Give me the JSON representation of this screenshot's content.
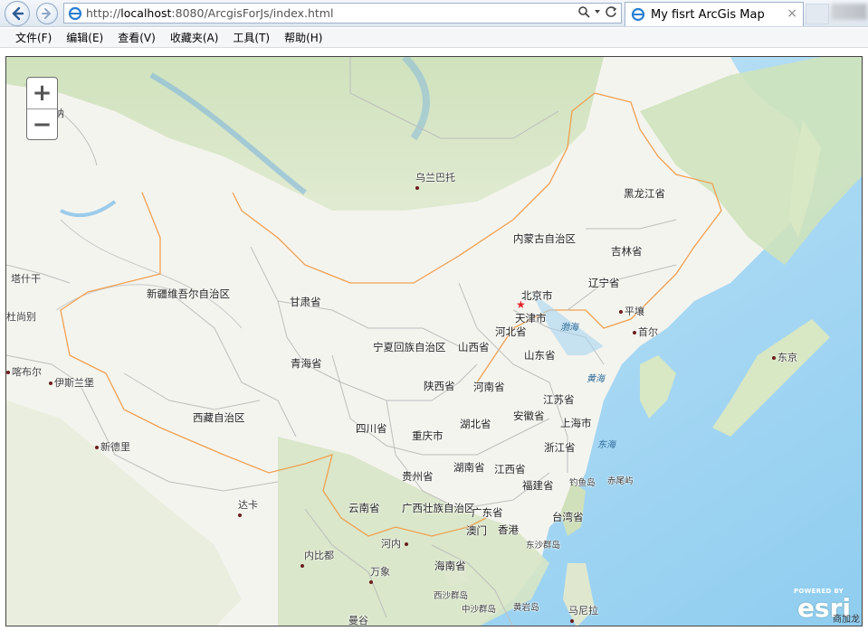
{
  "browser": {
    "url_prefix": "http://",
    "url_host": "localhost",
    "url_rest": ":8080/ArcgisForJs/index.html",
    "tab_title": "My fisrt ArcGis Map",
    "tab_close": "×"
  },
  "menu": [
    "文件(F)",
    "编辑(E)",
    "查看(V)",
    "收藏夹(A)",
    "工具(T)",
    "帮助(H)"
  ],
  "zoom": {
    "in_label": "+",
    "out_label": "−"
  },
  "esri": {
    "powered": "POWERED BY",
    "logo": "esri"
  },
  "attribution": "商加龙",
  "map_labels": {
    "provinces": {
      "xinjiang": "新疆维吾尔自治区",
      "gansu": "甘肃省",
      "qinghai": "青海省",
      "xizang": "西藏自治区",
      "neimenggu": "内蒙古自治区",
      "heilongjiang": "黑龙江省",
      "jilin": "吉林省",
      "liaoning": "辽宁省",
      "beijing": "北京市",
      "tianjin": "天津市",
      "hebei": "河北省",
      "shanxi": "山西省",
      "shandong": "山东省",
      "ningxia": "宁夏回族自治区",
      "shaanxi": "陕西省",
      "henan": "河南省",
      "jiangsu": "江苏省",
      "anhui": "安徽省",
      "shanghai": "上海市",
      "sichuan": "四川省",
      "chongqing": "重庆市",
      "hubei": "湖北省",
      "zhejiang": "浙江省",
      "guizhou": "贵州省",
      "hunan": "湖南省",
      "jiangxi": "江西省",
      "fujian": "福建省",
      "yunnan": "云南省",
      "guangxi": "广西壮族自治区",
      "guangdong": "广东省",
      "taiwan": "台湾省",
      "aomen": "澳门",
      "xianggang": "香港",
      "hainan": "海南省"
    },
    "cities": {
      "wulanbatuo": "乌兰巴托",
      "pingrang": "平壤",
      "shouer": "首尔",
      "dongjing": "东京",
      "tashigan": "塔什干",
      "dushanbie": "杜尚别",
      "kabuer": "喀布尔",
      "yisilanbao": "伊斯兰堡",
      "xindeli": "新德里",
      "daka": "达卡",
      "neibidu": "内比都",
      "henei": "河内",
      "wanxiang": "万象",
      "mangu": "曼谷",
      "manila": "马尼拉",
      "na": "纳"
    },
    "seas": {
      "bohai": "渤海",
      "huanghai": "黄海",
      "donghai": "东海"
    },
    "islands": {
      "diaoyu": "钓鱼岛",
      "chiwei": "赤尾屿",
      "dongsha": "东沙群岛",
      "xisha": "西沙群岛",
      "zhongsha": "中沙群岛",
      "huangyan": "黄岩岛"
    }
  }
}
